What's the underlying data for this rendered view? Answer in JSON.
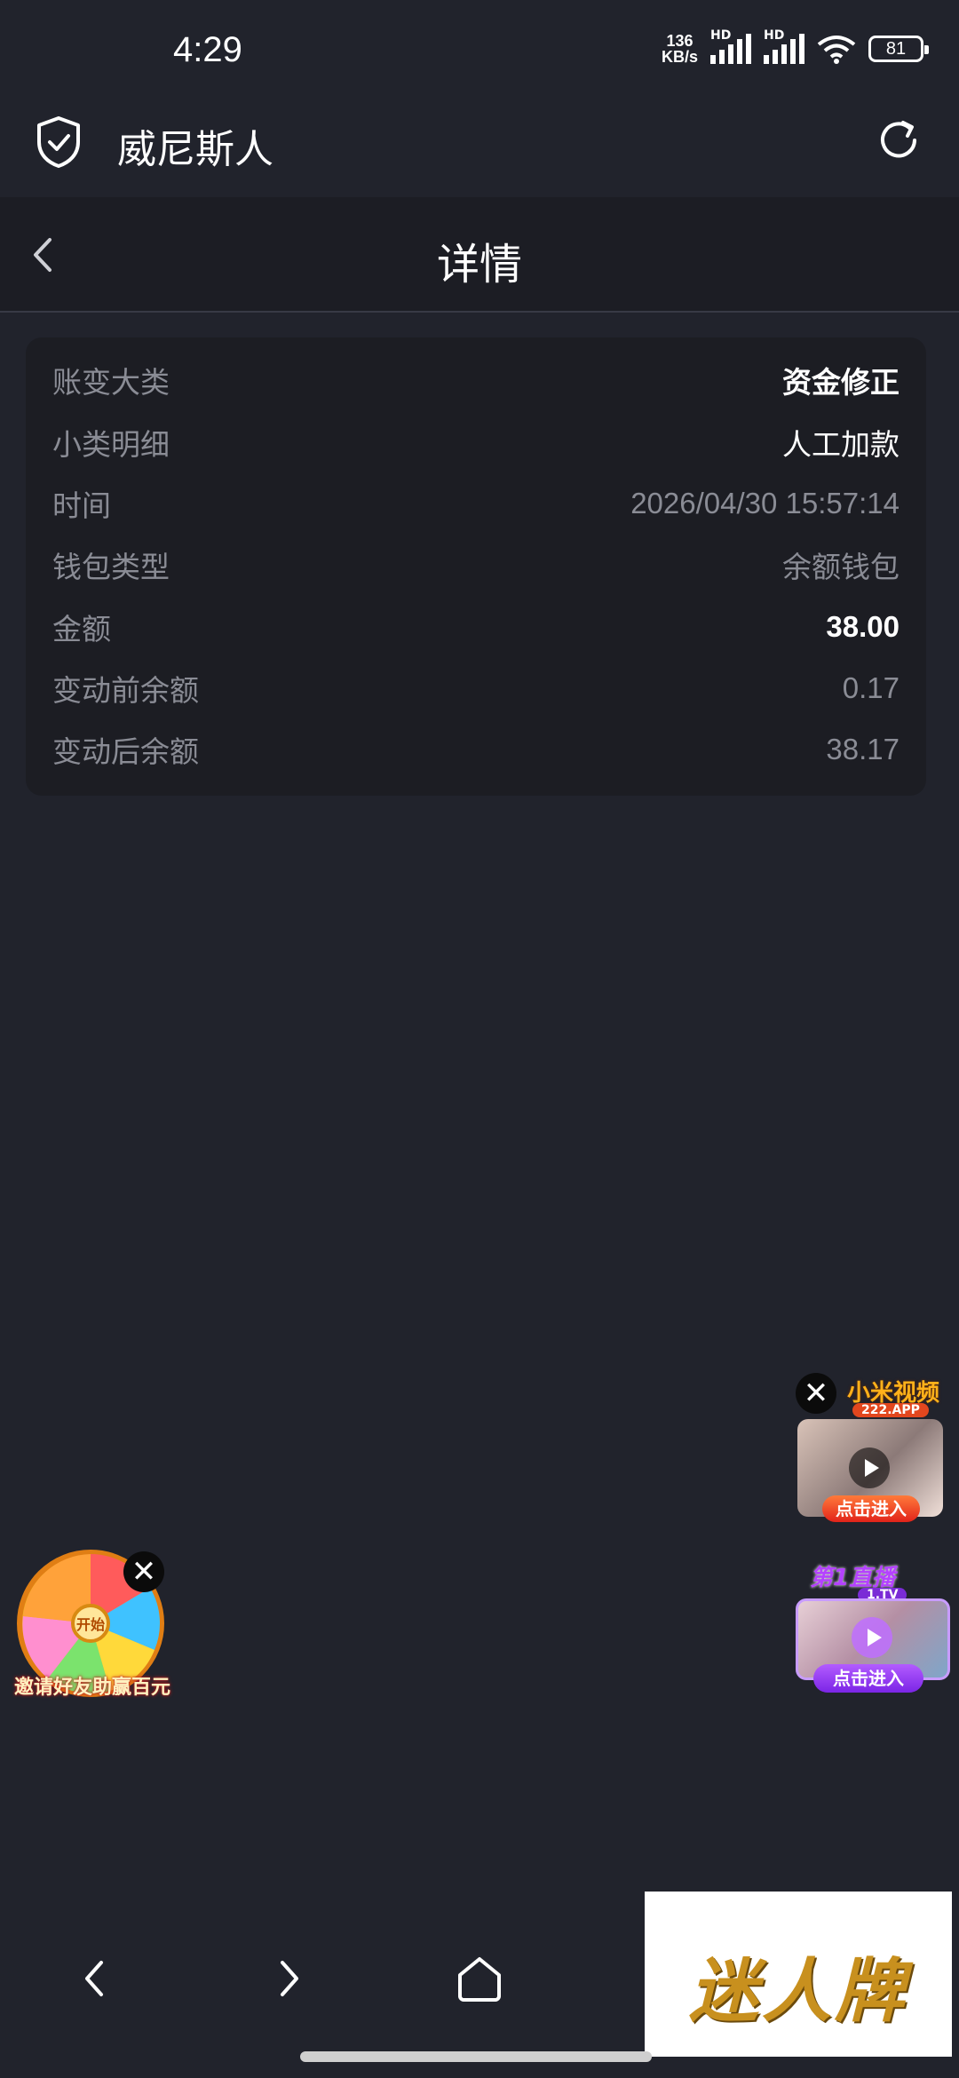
{
  "status_bar": {
    "time": "4:29",
    "net_speed_value": "136",
    "net_speed_unit": "KB/s",
    "signal_label": "HD",
    "battery": "81"
  },
  "app_bar": {
    "title": "威尼斯人",
    "icons": [
      "shield-check-icon",
      "refresh-icon"
    ]
  },
  "nav_header": {
    "title": "详情",
    "icons": [
      "chevron-left-icon"
    ]
  },
  "details": [
    {
      "label": "账变大类",
      "value": "资金修正"
    },
    {
      "label": "小类明细",
      "value": "人工加款"
    },
    {
      "label": "时间",
      "value": "2026/04/30 15:57:14"
    },
    {
      "label": "钱包类型",
      "value": "余额钱包"
    },
    {
      "label": "金额",
      "value": "38.00"
    },
    {
      "label": "变动前余额",
      "value": "0.17"
    },
    {
      "label": "变动后余额",
      "value": "38.17"
    }
  ],
  "ads": {
    "wheel_text": "邀请好友助赢百元",
    "wheel_center": "开始",
    "xiaomi_brand": "小米视频",
    "xiaomi_site": "222.APP",
    "xiaomi_button": "点击进入",
    "live_brand": "第1直播",
    "live_site": "1.TV",
    "live_button": "点击进入",
    "logo_text": "迷人牌",
    "close_label": "✕"
  },
  "bottom_nav": {
    "icons": [
      "back-arrow-icon",
      "forward-arrow-icon",
      "home-icon"
    ]
  },
  "colors": {
    "background": "#21232c",
    "card": "#1c1d23",
    "label": "#8a8c95",
    "value_highlight": "#ffffff"
  }
}
